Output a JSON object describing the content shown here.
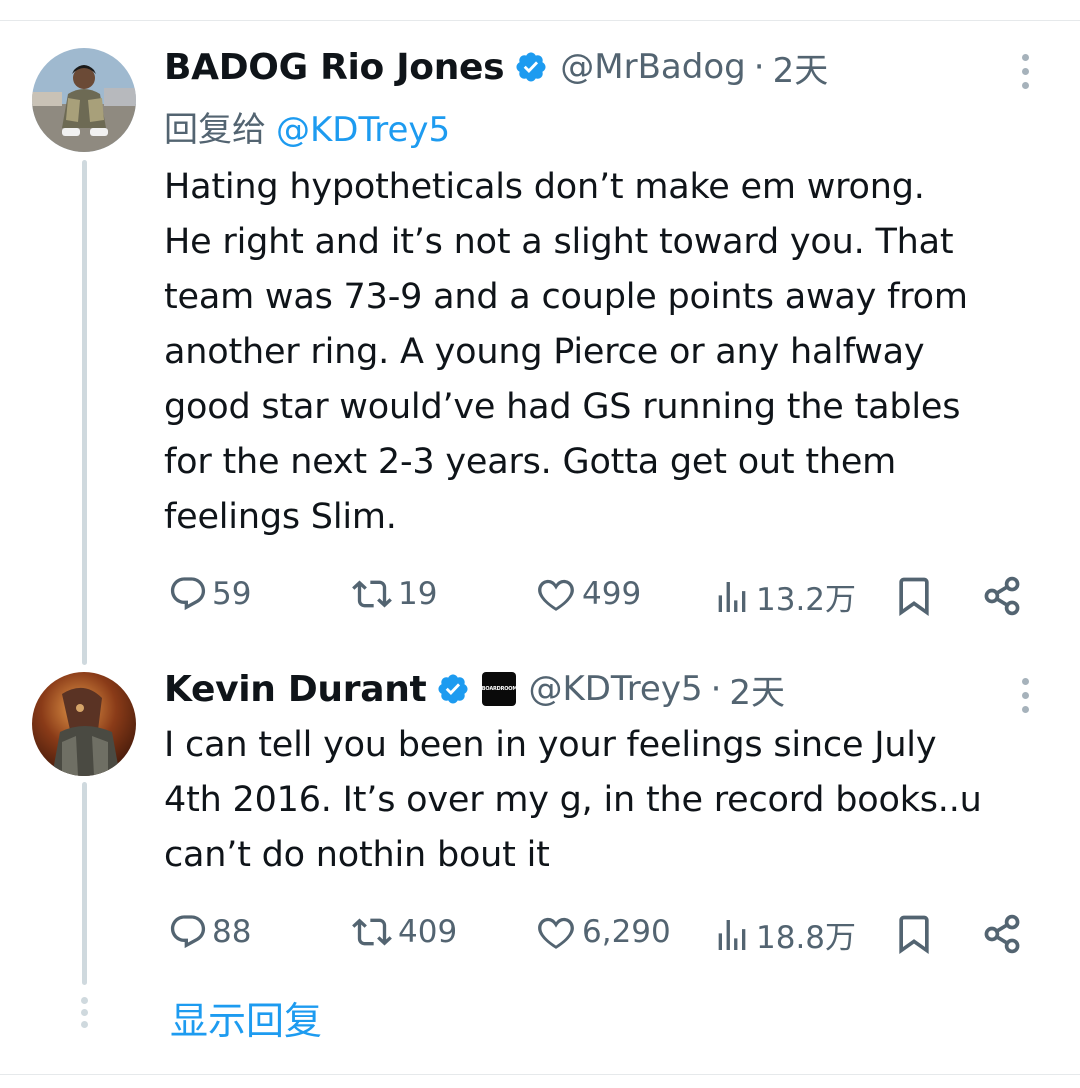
{
  "thread": {
    "show_replies_label": "显示回复",
    "tweets": [
      {
        "author_name": "BADOG Rio Jones",
        "handle": "@MrBadog",
        "separator": "·",
        "time": "2天",
        "reply_prefix": "回复给",
        "reply_mention": "@KDTrey5",
        "text": "Hating hypotheticals don’t make em wrong.\nHe right and it’s not a slight toward you. That\nteam was 73-9 and a couple points away from\nanother ring. A young Pierce or any halfway\ngood star would’ve had GS running the tables\nfor the next 2-3 years. Gotta get out them\nfeelings Slim.",
        "stats": {
          "replies": "59",
          "reposts": "19",
          "likes": "499",
          "views": "13.2万"
        }
      },
      {
        "author_name": "Kevin Durant",
        "handle": "@KDTrey5",
        "separator": "·",
        "time": "2天",
        "affiliation_badge": "BOARDROOM",
        "text": "I can tell you been in your feelings since July\n4th 2016. It’s over my g, in the record books..u\ncan’t do nothin bout it",
        "stats": {
          "replies": "88",
          "reposts": "409",
          "likes": "6,290",
          "views": "18.8万"
        }
      }
    ]
  },
  "colors": {
    "verified_blue": "#1d9bf0",
    "secondary_text": "#536471",
    "thread_line": "#cfd9de"
  },
  "icons": [
    "verified-badge-icon",
    "more-icon",
    "reply-icon",
    "repost-icon",
    "like-icon",
    "views-icon",
    "bookmark-icon",
    "share-icon"
  ]
}
